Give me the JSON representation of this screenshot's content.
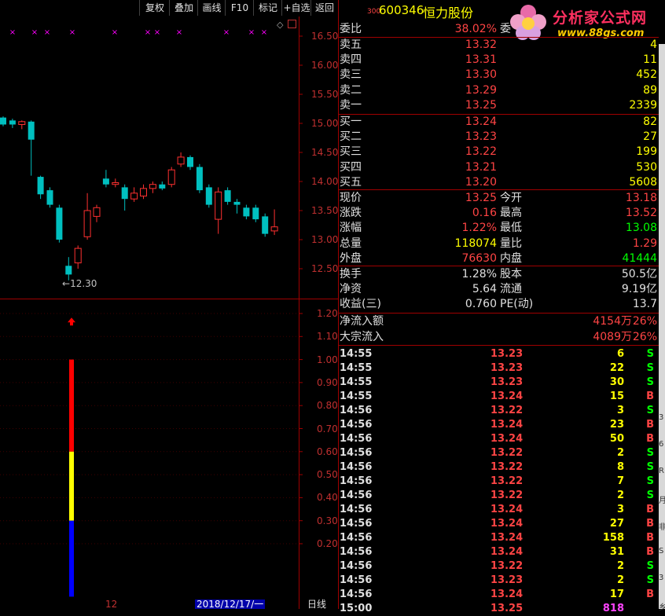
{
  "toolbar": {
    "buttons": [
      "复权",
      "叠加",
      "画线",
      "F10",
      "标记",
      "+自选",
      "返回"
    ]
  },
  "header": {
    "market_code": "300",
    "stock_code": "600346",
    "stock_name": "恒力股份",
    "truncated_char": "委",
    "logo_text": "分析家公式网",
    "logo_url_text": "www.88gs.com"
  },
  "price_axis": {
    "ticks": [
      "16.50",
      "16.00",
      "15.50",
      "15.00",
      "14.50",
      "14.00",
      "13.50",
      "13.00",
      "12.50"
    ],
    "low_marker_label": "12.30"
  },
  "indicator_axis": {
    "ticks": [
      "1.20",
      "1.10",
      "1.00",
      "0.90",
      "0.80",
      "0.70",
      "0.60",
      "0.50",
      "0.40",
      "0.30",
      "0.20"
    ],
    "bar_segments": [
      {
        "color": "#ff0000",
        "from": 0.6,
        "to": 1.0
      },
      {
        "color": "#ffff00",
        "from": 0.3,
        "to": 0.6
      },
      {
        "color": "#0000ff",
        "from": -0.03,
        "to": 0.3
      }
    ],
    "arrow_level": 1.1
  },
  "chart_data": {
    "type": "candlestick",
    "title": "",
    "ylim": [
      12.2,
      16.6
    ],
    "candles": [
      {
        "o": 15.1,
        "c": 14.98,
        "h": 15.12,
        "l": 14.95
      },
      {
        "o": 15.05,
        "c": 14.98,
        "h": 15.08,
        "l": 14.92
      },
      {
        "o": 14.98,
        "c": 15.03,
        "h": 15.05,
        "l": 14.9
      },
      {
        "o": 15.03,
        "c": 14.72,
        "h": 15.05,
        "l": 14.1
      },
      {
        "o": 14.08,
        "c": 13.78,
        "h": 14.1,
        "l": 13.7
      },
      {
        "o": 13.85,
        "c": 13.6,
        "h": 13.9,
        "l": 13.55
      },
      {
        "o": 13.55,
        "c": 13.0,
        "h": 13.6,
        "l": 12.95
      },
      {
        "o": 12.55,
        "c": 12.4,
        "h": 12.7,
        "l": 12.3
      },
      {
        "o": 12.6,
        "c": 12.85,
        "h": 12.9,
        "l": 12.5
      },
      {
        "o": 13.05,
        "c": 13.5,
        "h": 13.8,
        "l": 13.0
      },
      {
        "o": 13.4,
        "c": 13.55,
        "h": 13.6,
        "l": 13.3
      },
      {
        "o": 14.05,
        "c": 13.95,
        "h": 14.2,
        "l": 13.9
      },
      {
        "o": 13.95,
        "c": 13.98,
        "h": 14.05,
        "l": 13.9
      },
      {
        "o": 13.9,
        "c": 13.7,
        "h": 13.95,
        "l": 13.5
      },
      {
        "o": 13.7,
        "c": 13.8,
        "h": 13.9,
        "l": 13.65
      },
      {
        "o": 13.75,
        "c": 13.88,
        "h": 13.95,
        "l": 13.7
      },
      {
        "o": 13.88,
        "c": 13.95,
        "h": 14.0,
        "l": 13.8
      },
      {
        "o": 13.95,
        "c": 13.88,
        "h": 14.0,
        "l": 13.85
      },
      {
        "o": 13.95,
        "c": 14.2,
        "h": 14.25,
        "l": 13.9
      },
      {
        "o": 14.3,
        "c": 14.42,
        "h": 14.5,
        "l": 14.25
      },
      {
        "o": 14.42,
        "c": 14.25,
        "h": 14.45,
        "l": 14.2
      },
      {
        "o": 14.25,
        "c": 13.85,
        "h": 14.3,
        "l": 13.8
      },
      {
        "o": 13.9,
        "c": 13.6,
        "h": 13.95,
        "l": 13.55
      },
      {
        "o": 13.35,
        "c": 13.82,
        "h": 13.9,
        "l": 13.1
      },
      {
        "o": 13.85,
        "c": 13.65,
        "h": 13.9,
        "l": 13.6
      },
      {
        "o": 13.65,
        "c": 13.6,
        "h": 13.7,
        "l": 13.45
      },
      {
        "o": 13.55,
        "c": 13.4,
        "h": 13.6,
        "l": 13.35
      },
      {
        "o": 13.55,
        "c": 13.35,
        "h": 13.6,
        "l": 13.3
      },
      {
        "o": 13.4,
        "c": 13.1,
        "h": 13.45,
        "l": 13.05
      },
      {
        "o": 13.15,
        "c": 13.22,
        "h": 13.52,
        "l": 13.08
      }
    ]
  },
  "date_axis": {
    "label_12": "12",
    "label_date": "2018/12/17/一",
    "period": "日线"
  },
  "weibi": {
    "label": "委比",
    "value": "38.02%"
  },
  "order_book": {
    "sell": [
      {
        "label": "卖五",
        "price": "13.32",
        "qty": "4"
      },
      {
        "label": "卖四",
        "price": "13.31",
        "qty": "11"
      },
      {
        "label": "卖三",
        "price": "13.30",
        "qty": "452"
      },
      {
        "label": "卖二",
        "price": "13.29",
        "qty": "89"
      },
      {
        "label": "卖一",
        "price": "13.25",
        "qty": "2339"
      }
    ],
    "buy": [
      {
        "label": "买一",
        "price": "13.24",
        "qty": "82"
      },
      {
        "label": "买二",
        "price": "13.23",
        "qty": "27"
      },
      {
        "label": "买三",
        "price": "13.22",
        "qty": "199"
      },
      {
        "label": "买四",
        "price": "13.21",
        "qty": "530"
      },
      {
        "label": "买五",
        "price": "13.20",
        "qty": "5608"
      }
    ]
  },
  "quote": [
    {
      "l1": "现价",
      "v1": "13.25",
      "c1": "#ff4444",
      "l2": "今开",
      "v2": "13.18",
      "c2": "#ff4444"
    },
    {
      "l1": "涨跌",
      "v1": "0.16",
      "c1": "#ff4444",
      "l2": "最高",
      "v2": "13.52",
      "c2": "#ff4444"
    },
    {
      "l1": "涨幅",
      "v1": "1.22%",
      "c1": "#ff4444",
      "l2": "最低",
      "v2": "13.08",
      "c2": "#00ff00"
    },
    {
      "l1": "总量",
      "v1": "118074",
      "c1": "#ffff00",
      "l2": "量比",
      "v2": "1.29",
      "c2": "#ff4444"
    },
    {
      "l1": "外盘",
      "v1": "76630",
      "c1": "#ff4444",
      "l2": "内盘",
      "v2": "41444",
      "c2": "#00ff00"
    }
  ],
  "fundamentals": [
    {
      "l1": "换手",
      "v1": "1.28%",
      "l2": "股本",
      "v2": "50.5亿"
    },
    {
      "l1": "净资",
      "v1": "5.64",
      "l2": "流通",
      "v2": "9.19亿"
    },
    {
      "l1": "收益(三)",
      "v1": "0.760",
      "l2": "PE(动)",
      "v2": "13.7"
    }
  ],
  "flows": [
    {
      "label": "净流入额",
      "value": "4154万",
      "pct": "26%"
    },
    {
      "label": "大宗流入",
      "value": "4089万",
      "pct": "26%"
    }
  ],
  "ticks": [
    {
      "time": "14:55",
      "price": "13.23",
      "vol": "6",
      "side": "S"
    },
    {
      "time": "14:55",
      "price": "13.23",
      "vol": "22",
      "side": "S"
    },
    {
      "time": "14:55",
      "price": "13.23",
      "vol": "30",
      "side": "S"
    },
    {
      "time": "14:55",
      "price": "13.24",
      "vol": "15",
      "side": "B"
    },
    {
      "time": "14:56",
      "price": "13.22",
      "vol": "3",
      "side": "S"
    },
    {
      "time": "14:56",
      "price": "13.24",
      "vol": "23",
      "side": "B"
    },
    {
      "time": "14:56",
      "price": "13.24",
      "vol": "50",
      "side": "B"
    },
    {
      "time": "14:56",
      "price": "13.22",
      "vol": "2",
      "side": "S"
    },
    {
      "time": "14:56",
      "price": "13.22",
      "vol": "8",
      "side": "S"
    },
    {
      "time": "14:56",
      "price": "13.22",
      "vol": "7",
      "side": "S"
    },
    {
      "time": "14:56",
      "price": "13.22",
      "vol": "2",
      "side": "S"
    },
    {
      "time": "14:56",
      "price": "13.24",
      "vol": "3",
      "side": "B"
    },
    {
      "time": "14:56",
      "price": "13.24",
      "vol": "27",
      "side": "B"
    },
    {
      "time": "14:56",
      "price": "13.24",
      "vol": "158",
      "side": "B"
    },
    {
      "time": "14:56",
      "price": "13.24",
      "vol": "31",
      "side": "B"
    },
    {
      "time": "14:56",
      "price": "13.22",
      "vol": "2",
      "side": "S"
    },
    {
      "time": "14:56",
      "price": "13.23",
      "vol": "2",
      "side": "S"
    },
    {
      "time": "14:56",
      "price": "13.24",
      "vol": "17",
      "side": "B"
    },
    {
      "time": "15:00",
      "price": "13.25",
      "vol": "818",
      "side": ""
    }
  ],
  "right_strip": [
    "3",
    "6",
    "R",
    "月",
    "非",
    "S",
    "3",
    "乡"
  ]
}
